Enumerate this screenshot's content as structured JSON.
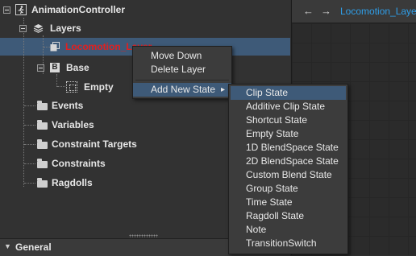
{
  "tree": {
    "root_label": "AnimationController",
    "layers_label": "Layers",
    "selected_layer_label": "Locomotion_Layer",
    "base_label": "Base",
    "empty_label": "Empty",
    "folders": [
      "Events",
      "Variables",
      "Constraint Targets",
      "Constraints",
      "Ragdolls"
    ],
    "selected_text_color": "#e02020",
    "selection_color": "#3e5a78"
  },
  "context_menu": {
    "items": [
      "Move Down",
      "Delete Layer"
    ],
    "submenu_trigger": "Add New State",
    "submenu_arrow": "▸"
  },
  "submenu": {
    "items": [
      "Clip State",
      "Additive Clip State",
      "Shortcut State",
      "Empty State",
      "1D BlendSpace State",
      "2D BlendSpace State",
      "Custom Blend State",
      "Group State",
      "Time State",
      "Ragdoll State",
      "Note",
      "TransitionSwitch"
    ],
    "highlighted_index": 0
  },
  "graph": {
    "back_icon": "arrow-left-icon",
    "forward_icon": "arrow-right-icon",
    "breadcrumb": "Locomotion_Layer",
    "accent": "#2f9ee8"
  },
  "inspector": {
    "section_label": "General"
  }
}
